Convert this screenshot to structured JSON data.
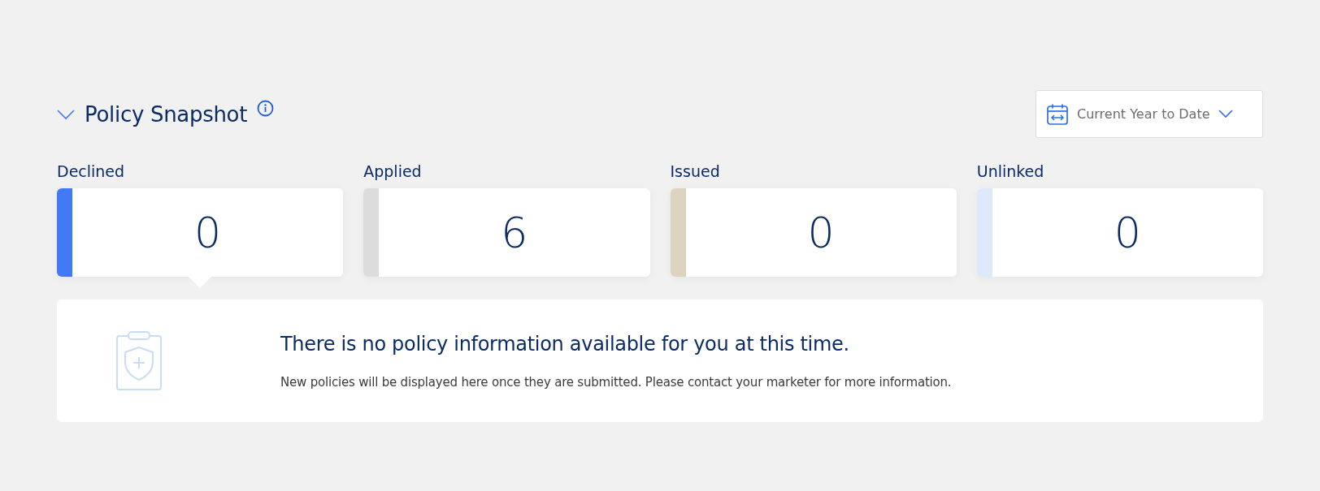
{
  "section": {
    "title": "Policy Snapshot",
    "expanded": true
  },
  "date_filter": {
    "value": "Current Year to Date"
  },
  "cards": [
    {
      "label": "Declined",
      "count": "0",
      "color": "#4479f5",
      "selected": true
    },
    {
      "label": "Applied",
      "count": "6",
      "color": "#dcdcdc",
      "selected": false
    },
    {
      "label": "Issued",
      "count": "0",
      "color": "#ddd3bf",
      "selected": false
    },
    {
      "label": "Unlinked",
      "count": "0",
      "color": "#dce9fb",
      "selected": false
    }
  ],
  "empty_state": {
    "heading": "There is no policy information available for you at this time.",
    "message": "New policies will be displayed here once they are submitted. Please contact your marketer for more information."
  }
}
